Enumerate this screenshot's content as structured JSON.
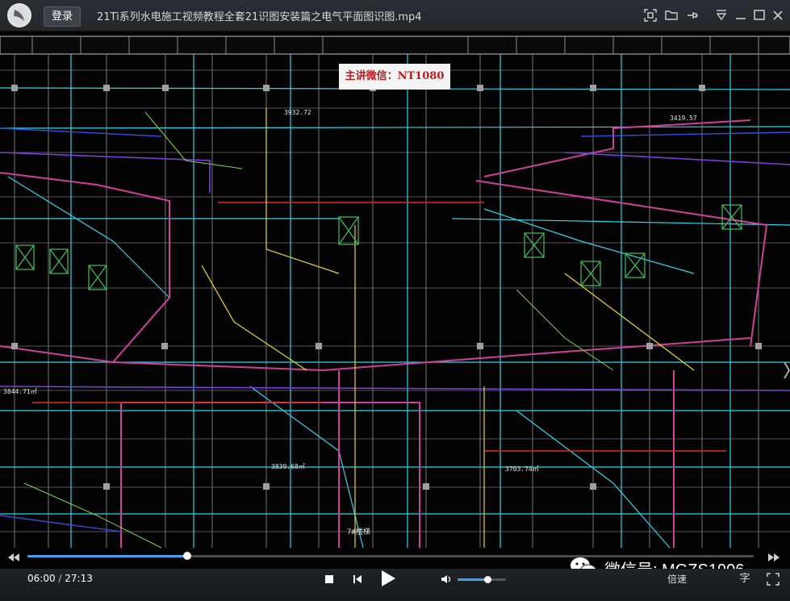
{
  "app": {
    "login_label": "登录",
    "window_title": "21Ti系列水电施工视频教程全套21识图安装篇之电气平面图识图.mp4"
  },
  "video": {
    "watermark_top": "主讲微信：NT1080",
    "watermark_bottom": "微信号: MGZS1906",
    "annotations": {
      "area1": "3844.71㎡",
      "area2": "3839.68㎡",
      "area3": "3703.74㎡",
      "area4": "3932.72",
      "area5": "3419.57",
      "stair": "7#楼梯"
    }
  },
  "player": {
    "current_time": "06:00",
    "separator": " / ",
    "total_time": "27:13",
    "progress": 0.22,
    "volume": 0.62,
    "speed_label": "倍速",
    "subtitle_label": "字"
  },
  "colors": {
    "accent": "#3fa1f2",
    "titlebar": "#2b2f33",
    "watermark_red": "#c0171c"
  }
}
